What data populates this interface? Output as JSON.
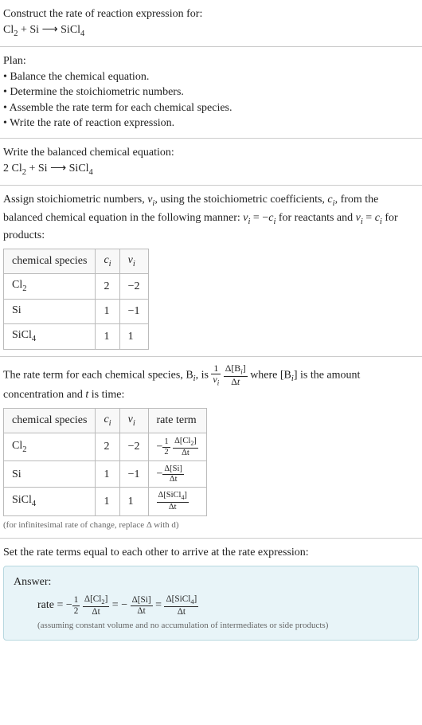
{
  "prompt": {
    "title": "Construct the rate of reaction expression for:",
    "eq_lhs1": "Cl",
    "eq_lhs1_sub": "2",
    "eq_plus1": " + Si ",
    "arrow": "⟶",
    "eq_rhs1": " SiCl",
    "eq_rhs1_sub": "4"
  },
  "plan": {
    "title": "Plan:",
    "items": [
      "• Balance the chemical equation.",
      "• Determine the stoichiometric numbers.",
      "• Assemble the rate term for each chemical species.",
      "• Write the rate of reaction expression."
    ]
  },
  "balanced": {
    "title": "Write the balanced chemical equation:",
    "coef1": "2 Cl",
    "sub1": "2",
    "plus": " + Si ",
    "arrow": "⟶",
    "rhs": " SiCl",
    "sub2": "4"
  },
  "stoich": {
    "intro1": "Assign stoichiometric numbers, ",
    "nu": "ν",
    "i": "i",
    "intro2": ", using the stoichiometric coefficients, ",
    "c": "c",
    "intro3": ", from the balanced chemical equation in the following manner: ",
    "rule1a": "ν",
    "rule1b": " = −",
    "rule1c": "c",
    "rule1d": " for reactants and ",
    "rule2a": "ν",
    "rule2b": " = ",
    "rule2c": "c",
    "rule2d": " for products:",
    "headers": [
      "chemical species",
      "c",
      "ν"
    ],
    "sub_i": "i",
    "rows": [
      {
        "sp": "Cl",
        "spsub": "2",
        "c": "2",
        "nu": "−2"
      },
      {
        "sp": "Si",
        "spsub": "",
        "c": "1",
        "nu": "−1"
      },
      {
        "sp": "SiCl",
        "spsub": "4",
        "c": "1",
        "nu": "1"
      }
    ]
  },
  "rateterm": {
    "intro1": "The rate term for each chemical species, B",
    "intro2": ", is ",
    "frac1_num": "1",
    "frac1_den1": "ν",
    "frac2_num1": "Δ[B",
    "frac2_num2": "]",
    "frac2_den1": "Δ",
    "frac2_den2": "t",
    "intro3": " where [B",
    "intro4": "] is the amount concentration and ",
    "t": "t",
    "intro5": " is time:",
    "headers": [
      "chemical species",
      "c",
      "ν",
      "rate term"
    ],
    "sub_i": "i",
    "rows": [
      {
        "sp": "Cl",
        "spsub": "2",
        "c": "2",
        "nu": "−2",
        "rt_prefix": "−",
        "rt_half_num": "1",
        "rt_half_den": "2",
        "rt_num": "Δ[Cl",
        "rt_numsub": "2",
        "rt_num2": "]",
        "rt_den": "Δt"
      },
      {
        "sp": "Si",
        "spsub": "",
        "c": "1",
        "nu": "−1",
        "rt_prefix": "−",
        "rt_half_num": "",
        "rt_half_den": "",
        "rt_num": "Δ[Si]",
        "rt_numsub": "",
        "rt_num2": "",
        "rt_den": "Δt"
      },
      {
        "sp": "SiCl",
        "spsub": "4",
        "c": "1",
        "nu": "1",
        "rt_prefix": "",
        "rt_half_num": "",
        "rt_half_den": "",
        "rt_num": "Δ[SiCl",
        "rt_numsub": "4",
        "rt_num2": "]",
        "rt_den": "Δt"
      }
    ],
    "note": "(for infinitesimal rate of change, replace Δ with d)"
  },
  "final": {
    "title": "Set the rate terms equal to each other to arrive at the rate expression:"
  },
  "answer": {
    "title": "Answer:",
    "rate": "rate = −",
    "half_num": "1",
    "half_den": "2",
    "t1_num": "Δ[Cl",
    "t1_numsub": "2",
    "t1_num2": "]",
    "t1_den": "Δt",
    "eq1": " = −",
    "t2_num": "Δ[Si]",
    "t2_den": "Δt",
    "eq2": " = ",
    "t3_num": "Δ[SiCl",
    "t3_numsub": "4",
    "t3_num2": "]",
    "t3_den": "Δt",
    "note": "(assuming constant volume and no accumulation of intermediates or side products)"
  }
}
